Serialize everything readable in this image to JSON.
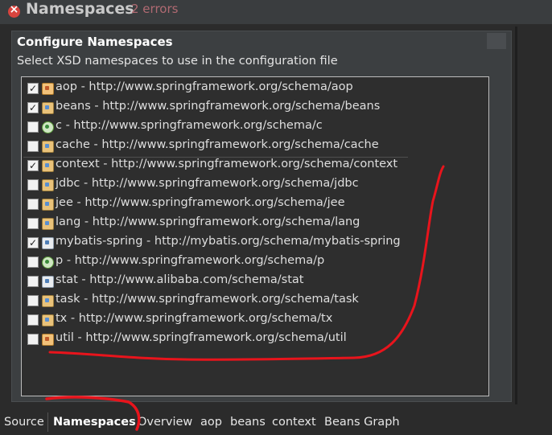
{
  "header": {
    "title": "Namespaces",
    "errors": "2 errors",
    "icon": "error-icon"
  },
  "section": {
    "title": "Configure Namespaces",
    "description": "Select XSD namespaces to use in the configuration file"
  },
  "namespaces": [
    {
      "label": "aop - http://www.springframework.org/schema/aop",
      "checked": true,
      "icon": "pin"
    },
    {
      "label": "beans - http://www.springframework.org/schema/beans",
      "checked": true,
      "icon": "bean"
    },
    {
      "label": "c - http://www.springframework.org/schema/c",
      "checked": false,
      "icon": "green"
    },
    {
      "label": "cache - http://www.springframework.org/schema/cache",
      "checked": false,
      "icon": "bean"
    },
    {
      "label": "context - http://www.springframework.org/schema/context",
      "checked": true,
      "icon": "bean"
    },
    {
      "label": "jdbc - http://www.springframework.org/schema/jdbc",
      "checked": false,
      "icon": "bean"
    },
    {
      "label": "jee - http://www.springframework.org/schema/jee",
      "checked": false,
      "icon": "bean"
    },
    {
      "label": "lang - http://www.springframework.org/schema/lang",
      "checked": false,
      "icon": "bean"
    },
    {
      "label": "mybatis-spring - http://mybatis.org/schema/mybatis-spring",
      "checked": true,
      "icon": "plain"
    },
    {
      "label": "p - http://www.springframework.org/schema/p",
      "checked": false,
      "icon": "green"
    },
    {
      "label": "stat - http://www.alibaba.com/schema/stat",
      "checked": false,
      "icon": "plain"
    },
    {
      "label": "task - http://www.springframework.org/schema/task",
      "checked": false,
      "icon": "bean"
    },
    {
      "label": "tx - http://www.springframework.org/schema/tx",
      "checked": false,
      "icon": "bean"
    },
    {
      "label": "util - http://www.springframework.org/schema/util",
      "checked": false,
      "icon": "bean"
    }
  ],
  "tabs": [
    {
      "label": "Source",
      "active": false
    },
    {
      "label": "Namespaces",
      "active": true
    },
    {
      "label": "Overview",
      "active": false
    },
    {
      "label": "aop",
      "active": false
    },
    {
      "label": "beans",
      "active": false
    },
    {
      "label": "context",
      "active": false
    },
    {
      "label": "Beans Graph",
      "active": false
    }
  ],
  "colors": {
    "background": "#2b2b2b",
    "annotation": "#e8141c",
    "error": "#d9443e"
  }
}
